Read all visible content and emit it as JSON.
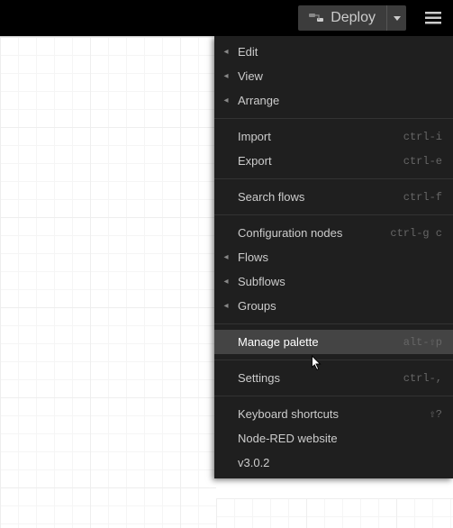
{
  "topbar": {
    "deploy_label": "Deploy"
  },
  "menu": {
    "groups": [
      [
        {
          "label": "Edit",
          "submenu": true,
          "shortcut": ""
        },
        {
          "label": "View",
          "submenu": true,
          "shortcut": ""
        },
        {
          "label": "Arrange",
          "submenu": true,
          "shortcut": ""
        }
      ],
      [
        {
          "label": "Import",
          "submenu": false,
          "shortcut": "ctrl-i"
        },
        {
          "label": "Export",
          "submenu": false,
          "shortcut": "ctrl-e"
        }
      ],
      [
        {
          "label": "Search flows",
          "submenu": false,
          "shortcut": "ctrl-f"
        }
      ],
      [
        {
          "label": "Configuration nodes",
          "submenu": false,
          "shortcut": "ctrl-g c"
        },
        {
          "label": "Flows",
          "submenu": true,
          "shortcut": ""
        },
        {
          "label": "Subflows",
          "submenu": true,
          "shortcut": ""
        },
        {
          "label": "Groups",
          "submenu": true,
          "shortcut": ""
        }
      ],
      [
        {
          "label": "Manage palette",
          "submenu": false,
          "shortcut": "alt-⇧p",
          "hovered": true
        }
      ],
      [
        {
          "label": "Settings",
          "submenu": false,
          "shortcut": "ctrl-,"
        }
      ],
      [
        {
          "label": "Keyboard shortcuts",
          "submenu": false,
          "shortcut": "⇧?"
        },
        {
          "label": "Node-RED website",
          "submenu": false,
          "shortcut": ""
        },
        {
          "label": "v3.0.2",
          "submenu": false,
          "shortcut": ""
        }
      ]
    ]
  }
}
